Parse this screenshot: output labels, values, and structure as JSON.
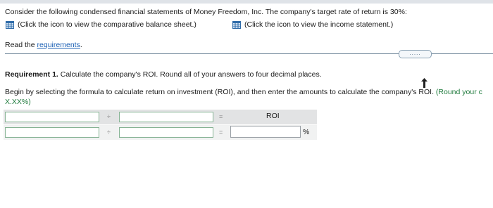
{
  "intro": "Consider the following condensed financial statements of Money Freedom, Inc. The company's target rate of return is 30%:",
  "links": {
    "balance_sheet": "(Click the icon to view the comparative balance sheet.)",
    "income_statement": "(Click the icon to view the income statement.)"
  },
  "read_prefix": "Read the ",
  "requirements_link": "requirements",
  "read_suffix": ".",
  "more_button": ".....",
  "requirement": {
    "title_bold": "Requirement 1.",
    "title_rest": " Calculate the company's ROI. Round all of your answers to four decimal places.",
    "instruction_line1": "Begin by selecting the formula to calculate return on investment (ROI), and then enter the amounts to calculate the company's ROI.",
    "instruction_hint_line1": " (Round your c",
    "instruction_hint_line2": "X.XX%)"
  },
  "formula": {
    "operator1": "÷",
    "operator2": "÷",
    "equals1": "=",
    "equals2": "=",
    "result_label": "ROI",
    "percent_sign": "%"
  },
  "inputs": {
    "row1_left": "",
    "row1_right": "",
    "row2_left": "",
    "row2_right": "",
    "row2_result": ""
  },
  "colors": {
    "link": "#1a5fb4",
    "hint": "#1e7a3c",
    "icon": "#2e6ba8"
  }
}
